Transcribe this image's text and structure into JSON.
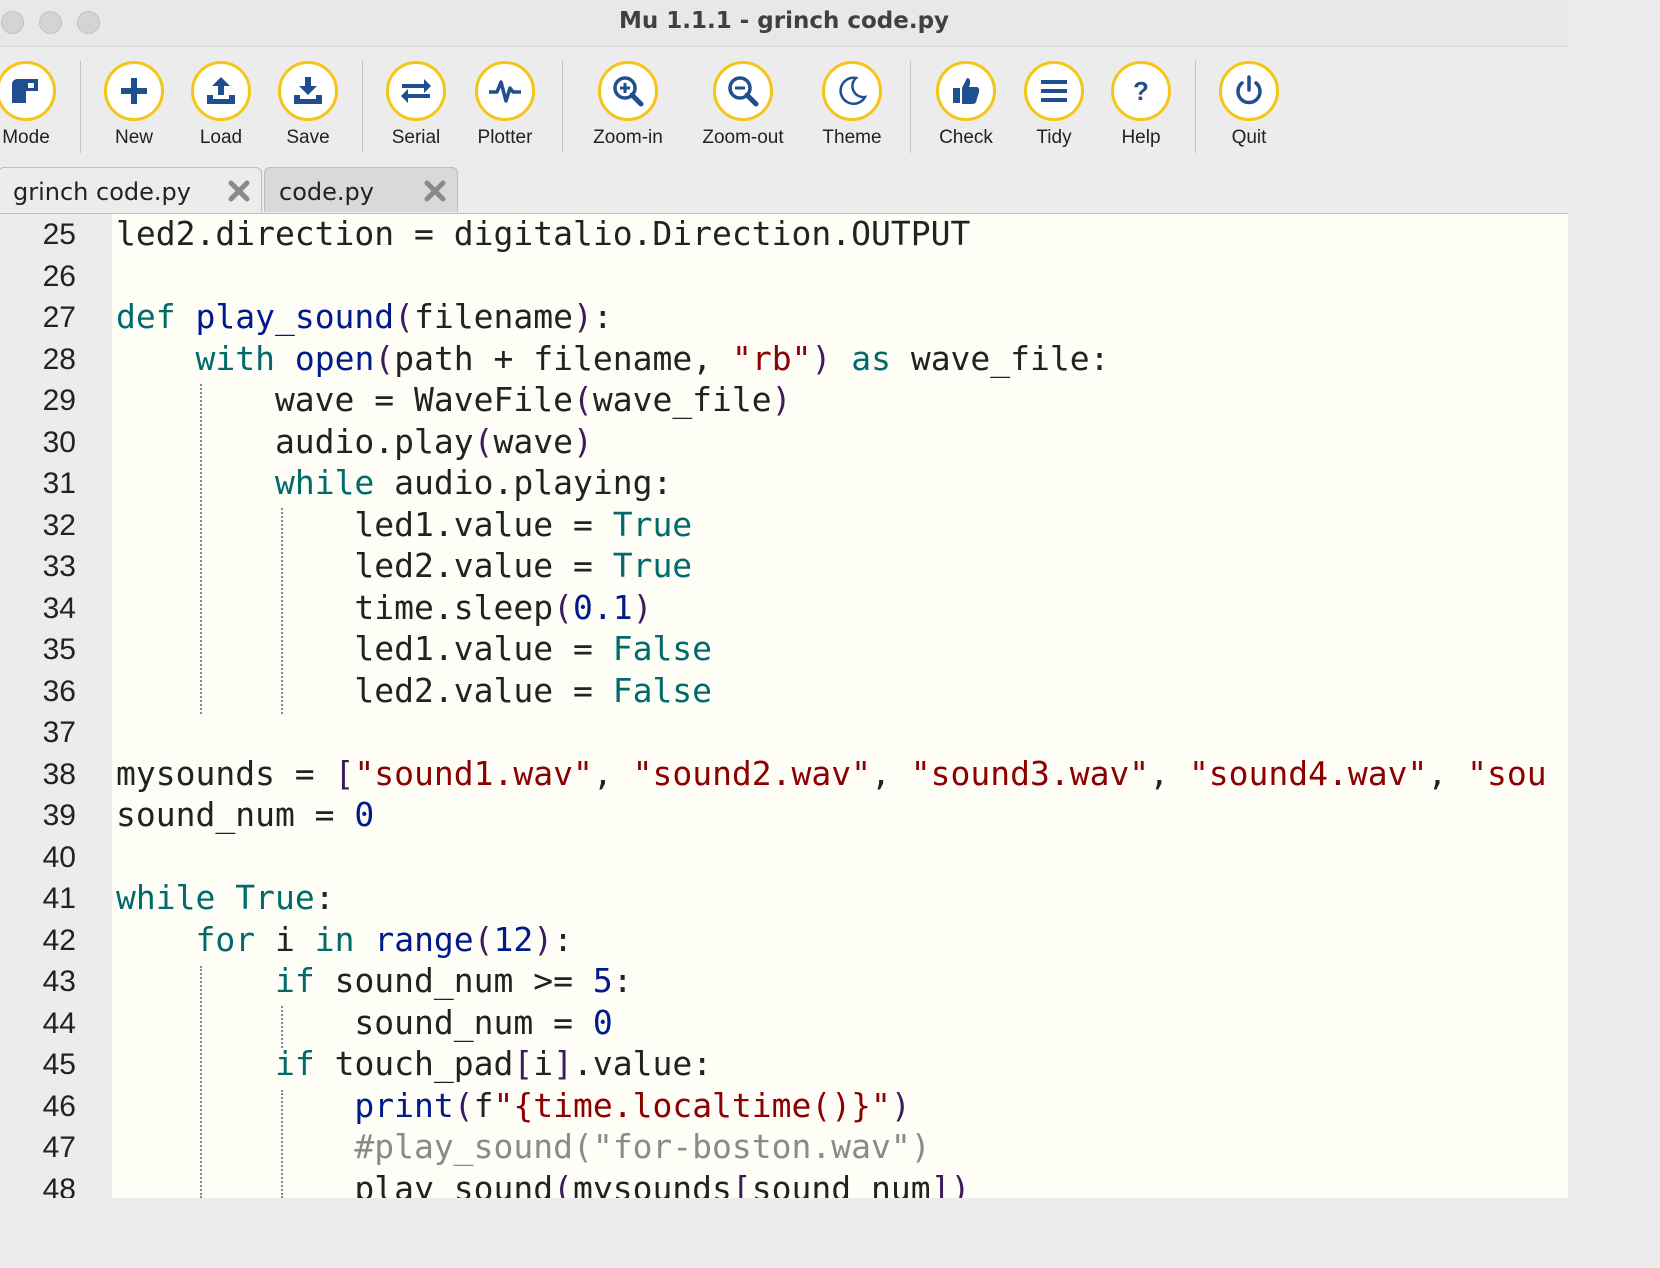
{
  "window": {
    "title": "Mu 1.1.1 - grinch code.py"
  },
  "toolbar": {
    "mode": "Mode",
    "new": "New",
    "load": "Load",
    "save": "Save",
    "serial": "Serial",
    "plotter": "Plotter",
    "zoom_in": "Zoom-in",
    "zoom_out": "Zoom-out",
    "theme": "Theme",
    "check": "Check",
    "tidy": "Tidy",
    "help": "Help",
    "quit": "Quit",
    "accent_color": "#f5c518"
  },
  "tabs": [
    {
      "name": "grinch code.py",
      "active": true
    },
    {
      "name": "code.py",
      "active": false
    }
  ],
  "editor": {
    "lines": [
      {
        "n": "25",
        "code": "led2.direction = digitalio.Direction.OUTPUT"
      },
      {
        "n": "26",
        "code": ""
      },
      {
        "n": "27",
        "code": "def play_sound(filename):"
      },
      {
        "n": "28",
        "code": "    with open(path + filename, \"rb\") as wave_file:"
      },
      {
        "n": "29",
        "code": "        wave = WaveFile(wave_file)"
      },
      {
        "n": "30",
        "code": "        audio.play(wave)"
      },
      {
        "n": "31",
        "code": "        while audio.playing:"
      },
      {
        "n": "32",
        "code": "            led1.value = True"
      },
      {
        "n": "33",
        "code": "            led2.value = True"
      },
      {
        "n": "34",
        "code": "            time.sleep(0.1)"
      },
      {
        "n": "35",
        "code": "            led1.value = False"
      },
      {
        "n": "36",
        "code": "            led2.value = False"
      },
      {
        "n": "37",
        "code": ""
      },
      {
        "n": "38",
        "code": "mysounds = [\"sound1.wav\", \"sound2.wav\", \"sound3.wav\", \"sound4.wav\", \"sou"
      },
      {
        "n": "39",
        "code": "sound_num = 0"
      },
      {
        "n": "40",
        "code": ""
      },
      {
        "n": "41",
        "code": "while True:"
      },
      {
        "n": "42",
        "code": "    for i in range(12):"
      },
      {
        "n": "43",
        "code": "        if sound_num >= 5:"
      },
      {
        "n": "44",
        "code": "            sound_num = 0"
      },
      {
        "n": "45",
        "code": "        if touch_pad[i].value:"
      },
      {
        "n": "46",
        "code": "            print(f\"{time.localtime()}\")"
      },
      {
        "n": "47",
        "code": "            #play_sound(\"for-boston.wav\")"
      },
      {
        "n": "48",
        "code": "            play_sound(mysounds[sound_num])"
      }
    ]
  }
}
